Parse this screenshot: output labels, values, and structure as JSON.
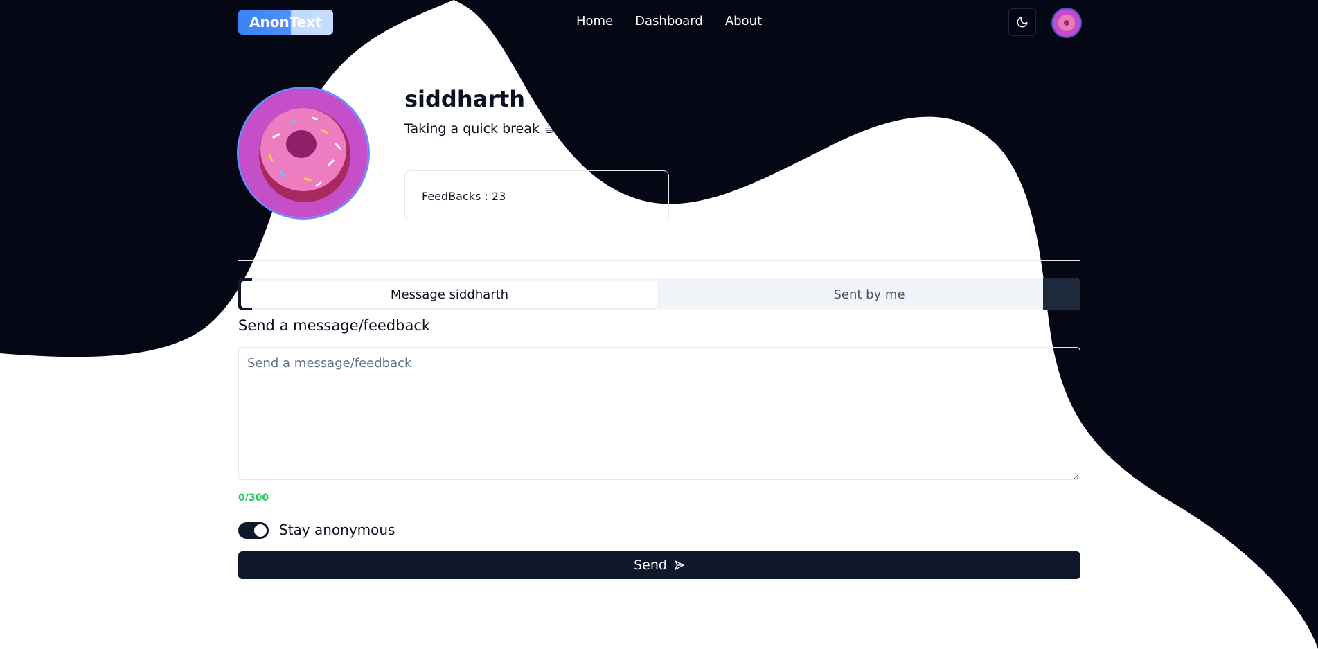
{
  "app": {
    "logo": "AnonText"
  },
  "nav": {
    "links": [
      "Home",
      "Dashboard",
      "About"
    ]
  },
  "icons": {
    "theme": "moon-icon",
    "send": "send-arrow-icon",
    "avatar": "donut-avatar"
  },
  "profile": {
    "username": "siddharth",
    "status": "Taking a quick break ☕",
    "feedbacks_label": "FeedBacks : 23"
  },
  "tabs": {
    "active": "Message siddharth",
    "inactive": "Sent by me"
  },
  "form": {
    "title": "Send a message/feedback",
    "placeholder": "Send a message/feedback",
    "value": "",
    "counter": "0/300",
    "anonymous_label": "Stay anonymous",
    "anonymous_on": true,
    "send_label": "Send"
  },
  "colors": {
    "dark": "#050814",
    "accent": "#3b82f6",
    "counter": "#22c55e",
    "button": "#0f172a"
  }
}
